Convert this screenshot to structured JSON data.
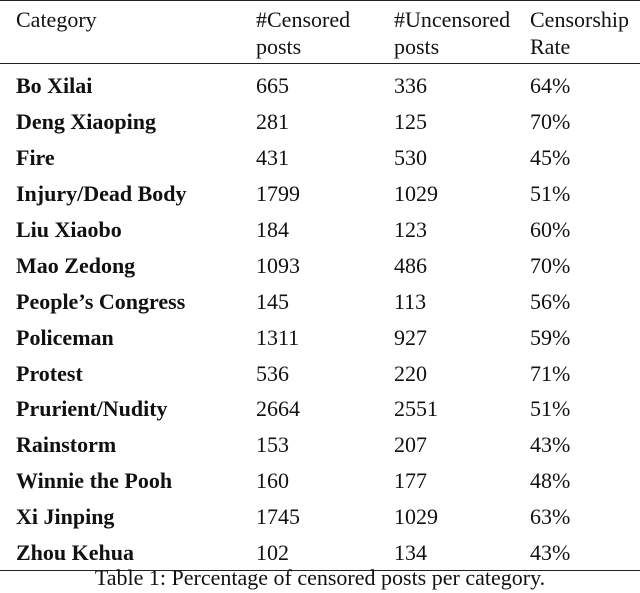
{
  "table": {
    "headers": [
      [
        "Category",
        ""
      ],
      [
        "#Censored",
        "posts"
      ],
      [
        "#Uncensored",
        "posts"
      ],
      [
        "Censorship",
        "Rate"
      ]
    ],
    "rows": [
      {
        "category": "Bo Xilai",
        "censored": "665",
        "uncensored": "336",
        "rate": "64%"
      },
      {
        "category": "Deng Xiaoping",
        "censored": "281",
        "uncensored": "125",
        "rate": "70%"
      },
      {
        "category": "Fire",
        "censored": "431",
        "uncensored": "530",
        "rate": "45%"
      },
      {
        "category": "Injury/Dead Body",
        "censored": "1799",
        "uncensored": "1029",
        "rate": "51%"
      },
      {
        "category": "Liu Xiaobo",
        "censored": "184",
        "uncensored": "123",
        "rate": "60%"
      },
      {
        "category": "Mao Zedong",
        "censored": "1093",
        "uncensored": "486",
        "rate": "70%"
      },
      {
        "category": "People’s Congress",
        "censored": "145",
        "uncensored": "113",
        "rate": "56%"
      },
      {
        "category": "Policeman",
        "censored": "1311",
        "uncensored": "927",
        "rate": "59%"
      },
      {
        "category": "Protest",
        "censored": "536",
        "uncensored": "220",
        "rate": "71%"
      },
      {
        "category": "Prurient/Nudity",
        "censored": "2664",
        "uncensored": "2551",
        "rate": "51%"
      },
      {
        "category": "Rainstorm",
        "censored": "153",
        "uncensored": "207",
        "rate": "43%"
      },
      {
        "category": "Winnie the Pooh",
        "censored": "160",
        "uncensored": "177",
        "rate": "48%"
      },
      {
        "category": "Xi Jinping",
        "censored": "1745",
        "uncensored": "1029",
        "rate": "63%"
      },
      {
        "category": "Zhou Kehua",
        "censored": "102",
        "uncensored": "134",
        "rate": "43%"
      }
    ],
    "caption": "Table 1: Percentage of censored posts per category."
  }
}
